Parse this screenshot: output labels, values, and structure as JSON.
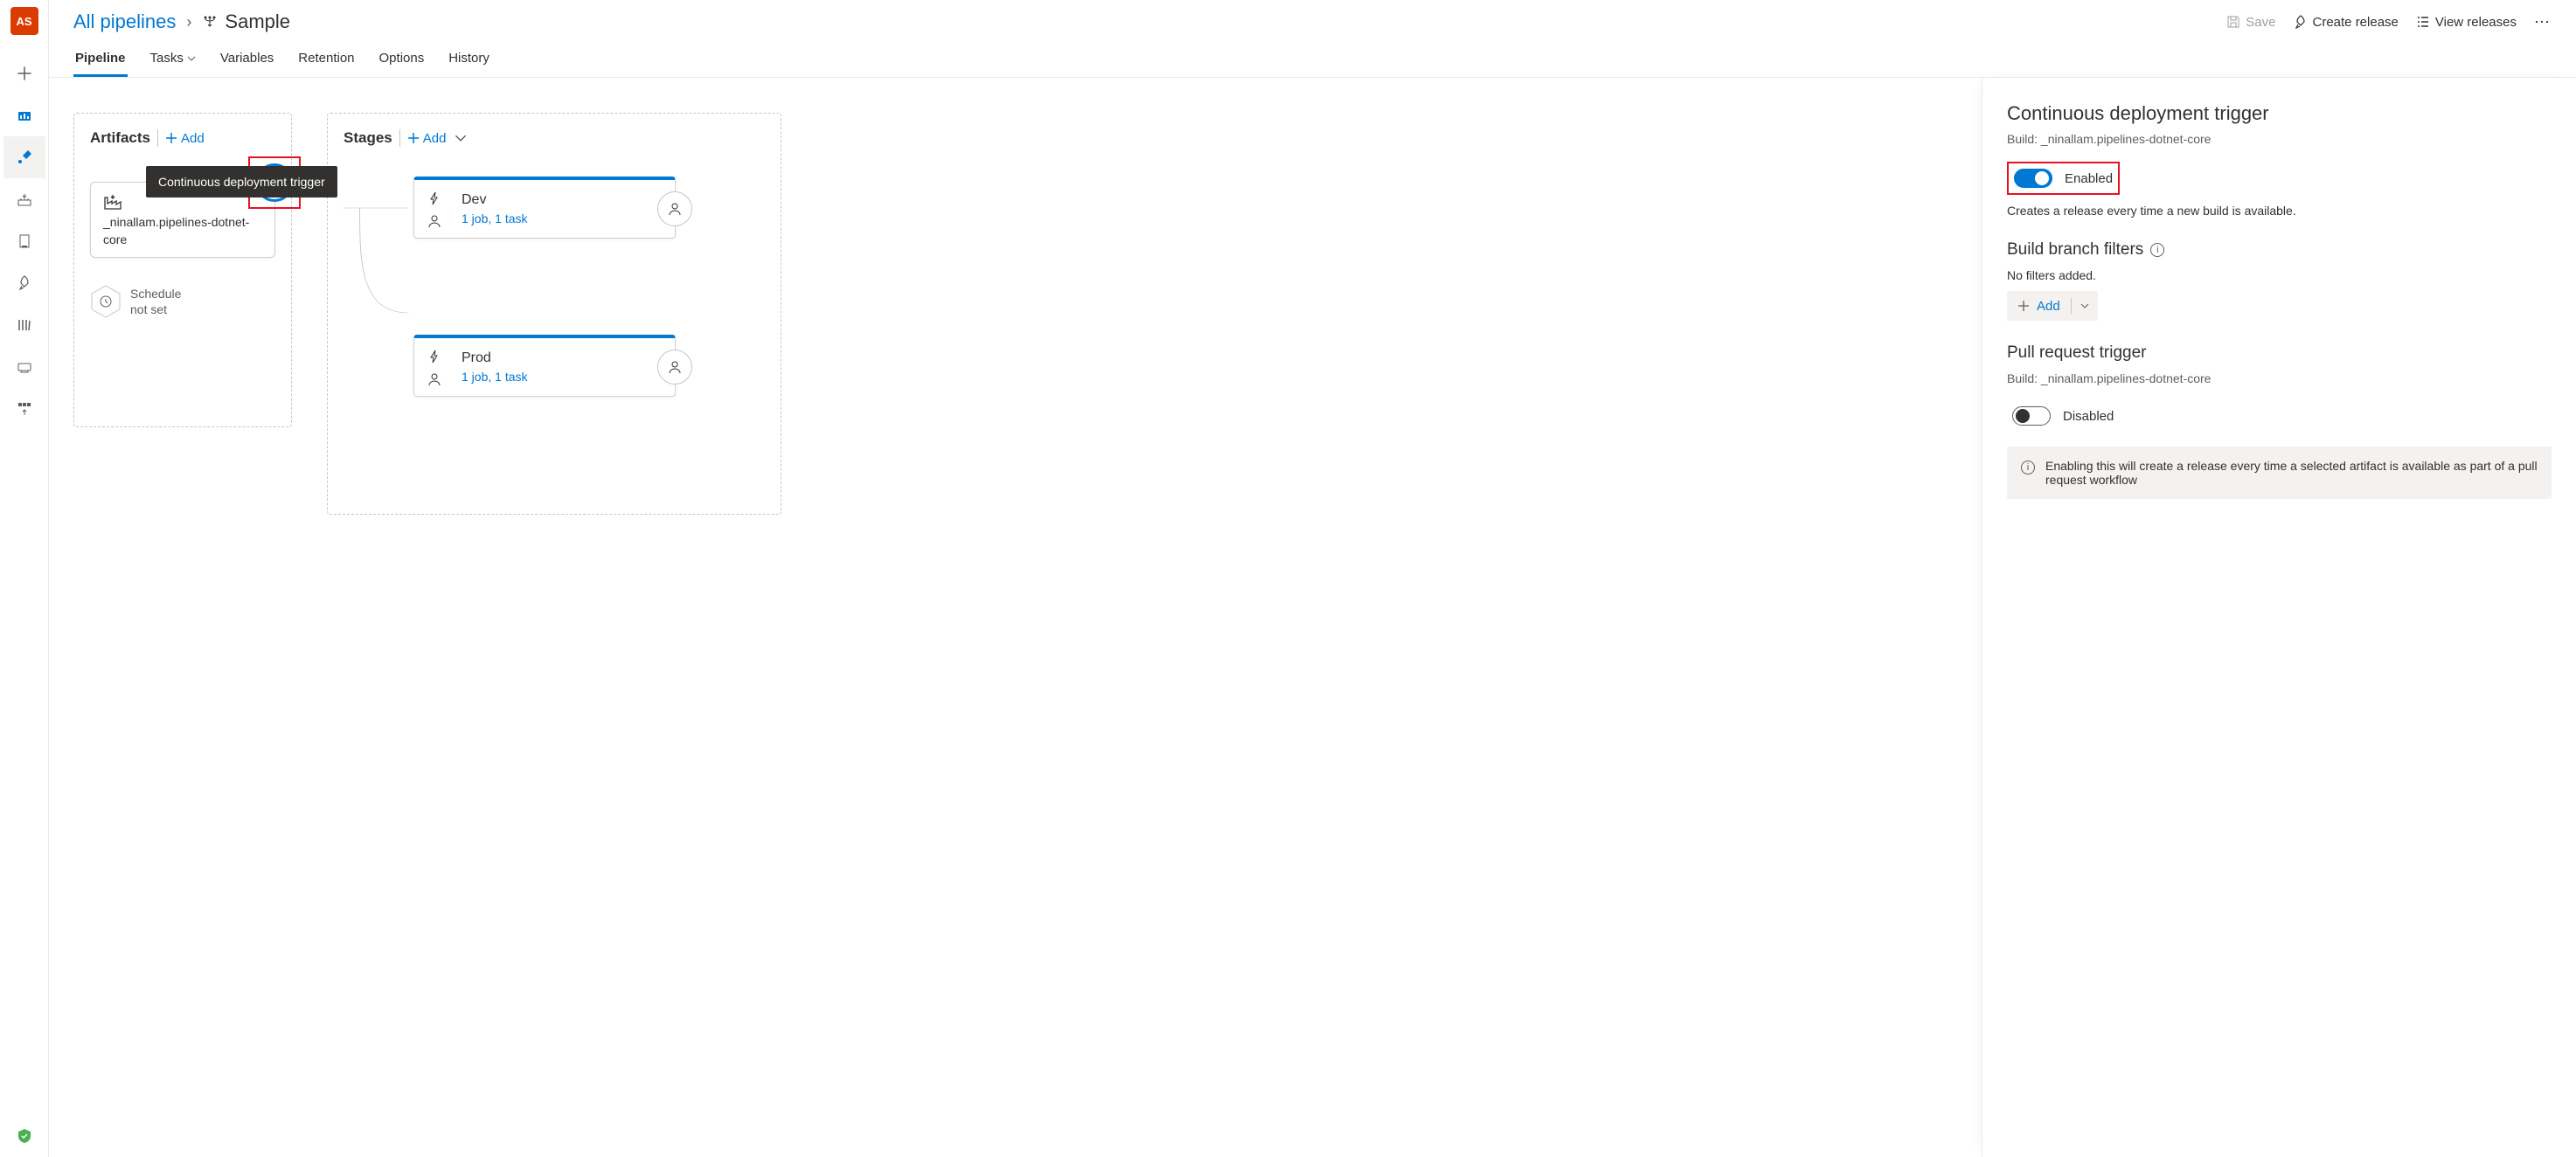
{
  "nav": {
    "logo": "AS"
  },
  "breadcrumb": {
    "root": "All pipelines",
    "title": "Sample"
  },
  "headerActions": {
    "save": "Save",
    "createRelease": "Create release",
    "viewReleases": "View releases"
  },
  "tabs": {
    "pipeline": "Pipeline",
    "tasks": "Tasks",
    "variables": "Variables",
    "retention": "Retention",
    "options": "Options",
    "history": "History"
  },
  "canvas": {
    "artifactsTitle": "Artifacts",
    "stagesTitle": "Stages",
    "addLabel": "Add",
    "tooltip": "Continuous deployment trigger",
    "artifactName": "_ninallam.pipelines-dotnet-core",
    "scheduleLine1": "Schedule",
    "scheduleLine2": "not set",
    "stages": [
      {
        "name": "Dev",
        "sub": "1 job, 1 task"
      },
      {
        "name": "Prod",
        "sub": "1 job, 1 task"
      }
    ]
  },
  "rightPanel": {
    "cdTrigger": {
      "title": "Continuous deployment trigger",
      "build": "Build: _ninallam.pipelines-dotnet-core",
      "enabledLabel": "Enabled",
      "desc": "Creates a release every time a new build is available."
    },
    "branchFilters": {
      "title": "Build branch filters",
      "empty": "No filters added.",
      "add": "Add"
    },
    "prTrigger": {
      "title": "Pull request trigger",
      "build": "Build: _ninallam.pipelines-dotnet-core",
      "disabledLabel": "Disabled",
      "callout": "Enabling this will create a release every time a selected artifact is available as part of a pull request workflow"
    }
  }
}
